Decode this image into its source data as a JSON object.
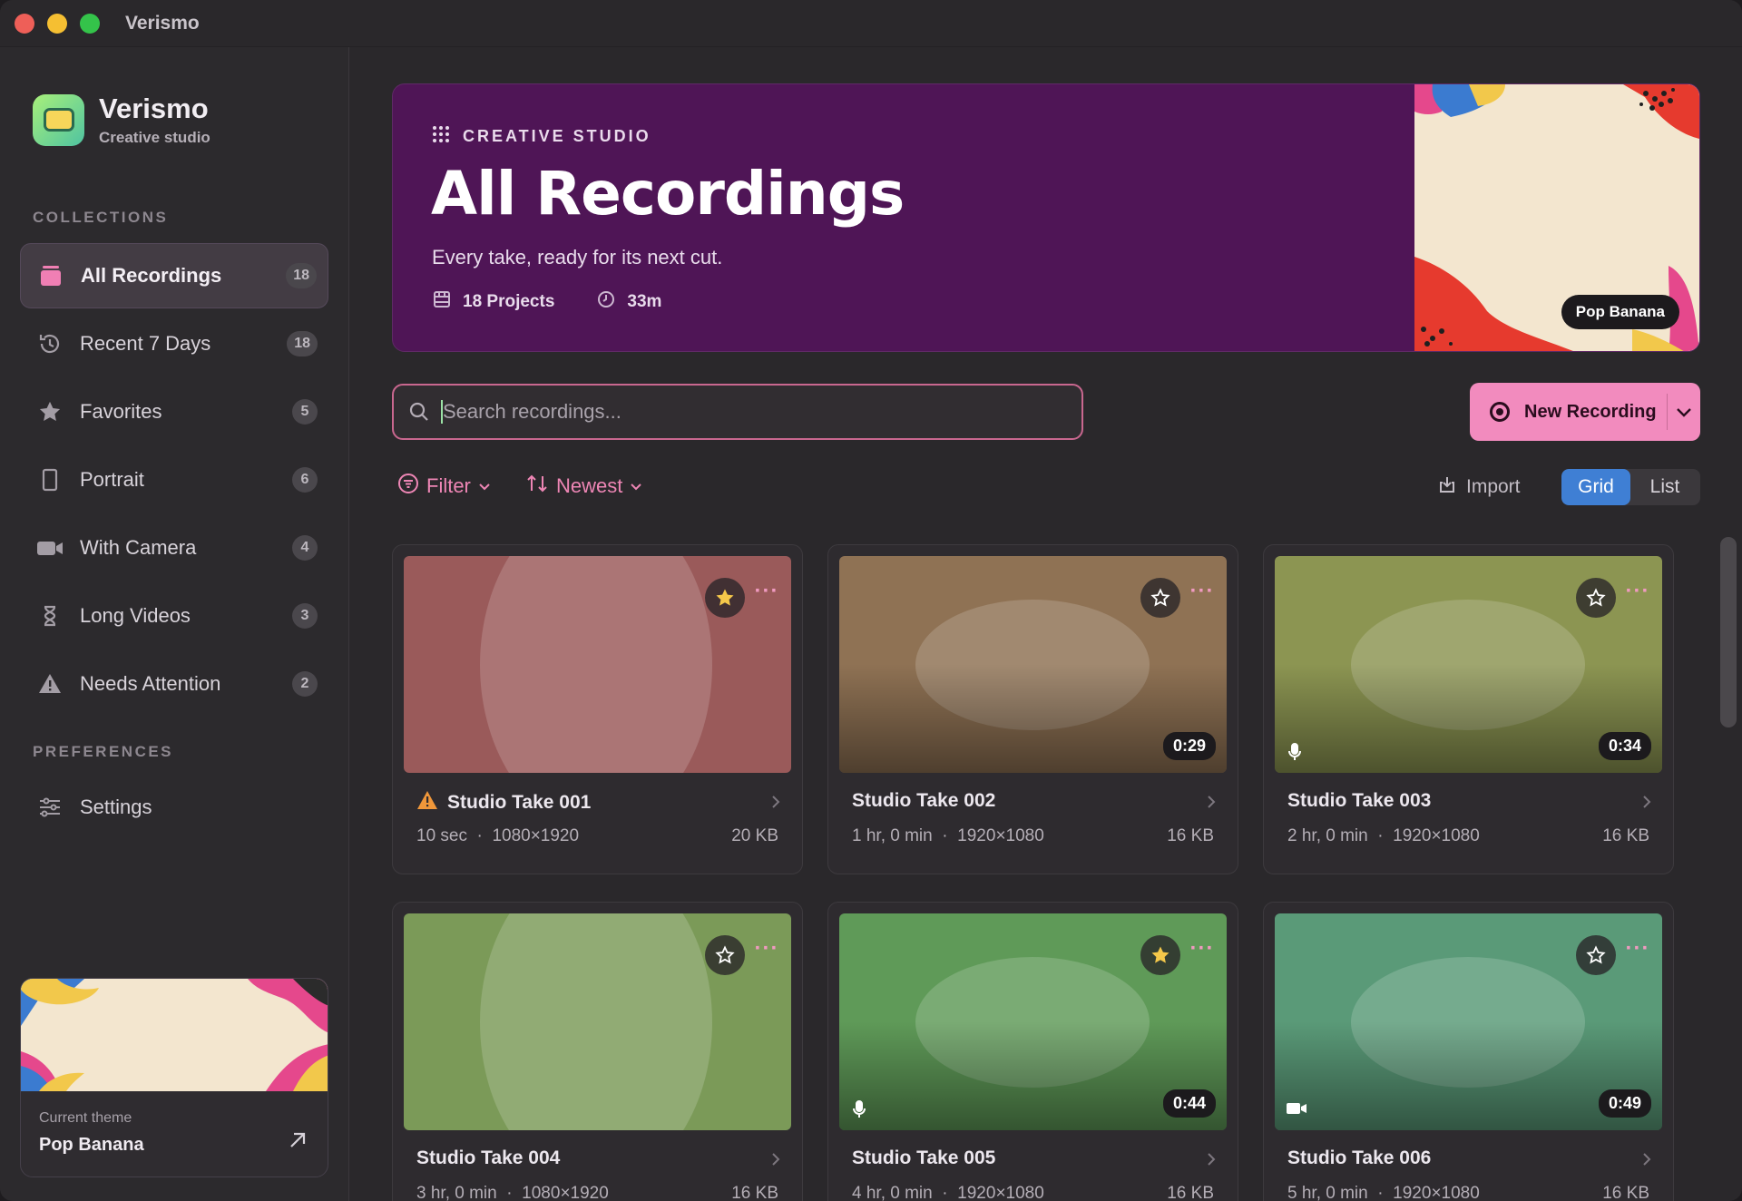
{
  "window": {
    "title": "Verismo"
  },
  "brand": {
    "name": "Verismo",
    "subtitle": "Creative studio"
  },
  "sidebar": {
    "collections_label": "COLLECTIONS",
    "items": [
      {
        "label": "All Recordings",
        "count": "18",
        "icon": "recordings-stack-icon",
        "active": true
      },
      {
        "label": "Recent 7 Days",
        "count": "18",
        "icon": "history-clock-icon"
      },
      {
        "label": "Favorites",
        "count": "5",
        "icon": "star-icon"
      },
      {
        "label": "Portrait",
        "count": "6",
        "icon": "portrait-icon"
      },
      {
        "label": "With Camera",
        "count": "4",
        "icon": "video-camera-icon"
      },
      {
        "label": "Long Videos",
        "count": "3",
        "icon": "hourglass-icon"
      },
      {
        "label": "Needs Attention",
        "count": "2",
        "icon": "warning-icon"
      }
    ],
    "preferences_label": "PREFERENCES",
    "settings_label": "Settings",
    "theme": {
      "caption": "Current theme",
      "name": "Pop Banana"
    }
  },
  "hero": {
    "kicker": "CREATIVE STUDIO",
    "title": "All Recordings",
    "subtitle": "Every take, ready for its next cut.",
    "projects": "18 Projects",
    "duration": "33m",
    "theme_badge": "Pop Banana"
  },
  "search": {
    "placeholder": "Search recordings..."
  },
  "actions": {
    "new_recording": "New Recording",
    "filter": "Filter",
    "sort": "Newest",
    "import": "Import",
    "view_grid": "Grid",
    "view_list": "List",
    "active_view": "Grid"
  },
  "colors": {
    "accent_pink": "#f28bbe",
    "hero_purple": "#4f1556",
    "grid_active": "#3f7fd4",
    "star_gold": "#f5c84a",
    "warning_orange": "#f0973a"
  },
  "recordings": [
    {
      "title": "Studio Take 001",
      "duration_label": "10 sec",
      "resolution": "1080×1920",
      "size": "20 KB",
      "badge": "",
      "favorite": true,
      "warning": true,
      "media": "",
      "color": "#9a5a5a"
    },
    {
      "title": "Studio Take 002",
      "duration_label": "1 hr, 0 min",
      "resolution": "1920×1080",
      "size": "16 KB",
      "badge": "0:29",
      "favorite": false,
      "warning": false,
      "media": "",
      "color": "#8f7254"
    },
    {
      "title": "Studio Take 003",
      "duration_label": "2 hr, 0 min",
      "resolution": "1920×1080",
      "size": "16 KB",
      "badge": "0:34",
      "favorite": false,
      "warning": false,
      "media": "microphone-icon",
      "color": "#8c9552"
    },
    {
      "title": "Studio Take 004",
      "duration_label": "3 hr, 0 min",
      "resolution": "1080×1920",
      "size": "16 KB",
      "badge": "",
      "favorite": false,
      "warning": false,
      "media": "",
      "color": "#7b9a58"
    },
    {
      "title": "Studio Take 005",
      "duration_label": "4 hr, 0 min",
      "resolution": "1920×1080",
      "size": "16 KB",
      "badge": "0:44",
      "favorite": true,
      "warning": false,
      "media": "microphone-icon",
      "color": "#5f9a58"
    },
    {
      "title": "Studio Take 006",
      "duration_label": "5 hr, 0 min",
      "resolution": "1920×1080",
      "size": "16 KB",
      "badge": "0:49",
      "favorite": false,
      "warning": false,
      "media": "video-camera-icon",
      "color": "#5a9a78"
    }
  ]
}
